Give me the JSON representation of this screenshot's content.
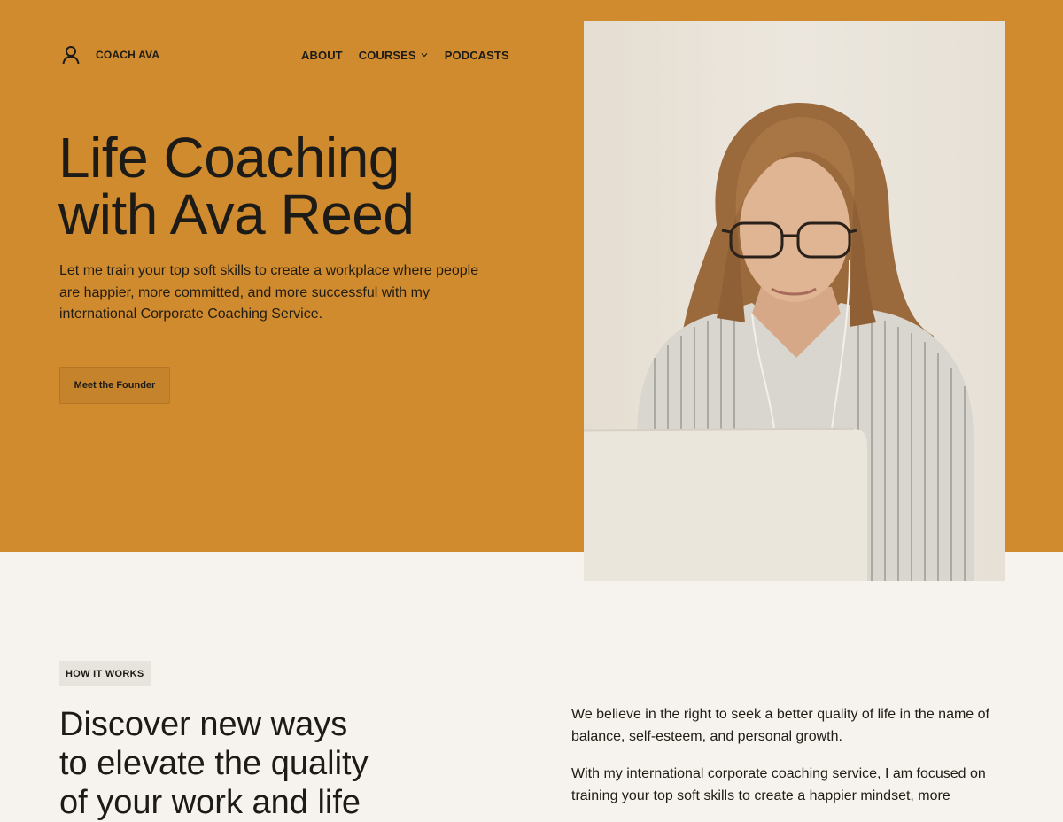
{
  "colors": {
    "hero_background": "#cf8b2e",
    "page_background": "#f6f3ee",
    "text": "#1d1b17",
    "button_background": "#c5842c",
    "tag_background": "#e7e4de"
  },
  "brand": {
    "icon": "user-icon",
    "name": "COACH AVA"
  },
  "nav": {
    "items": [
      {
        "label": "ABOUT"
      },
      {
        "label": "COURSES",
        "icon": "chevron-down-icon"
      },
      {
        "label": "PODCASTS"
      }
    ]
  },
  "hero": {
    "title": "Life Coaching\nwith Ava Reed",
    "description": "Let me train your top soft skills to create a workplace where people are happier, more committed, and more successful with my international Corporate Coaching Service.",
    "button_label": "Meet the Founder",
    "image_icon": "coach-photo"
  },
  "how_it_works": {
    "tag": "HOW IT WORKS",
    "title": "Discover new ways\nto elevate the quality\nof your work and life",
    "paragraphs": [
      "We believe in the right to seek a better quality of life in the name of balance, self-esteem, and personal growth.",
      "With my international corporate coaching service, I am focused on training your top soft skills to create a happier mindset, more"
    ]
  }
}
